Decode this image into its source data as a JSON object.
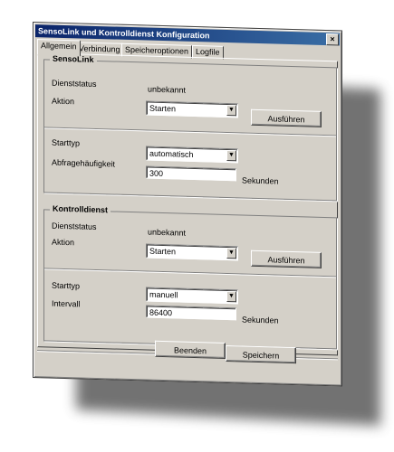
{
  "window": {
    "title": "SensoLink und Kontrolldienst Konfiguration",
    "close": "×"
  },
  "tabs": [
    "Allgemein",
    "Verbindung",
    "Speicheroptionen",
    "Logfile"
  ],
  "sensolink": {
    "group_title": "SensoLink",
    "status_label": "Dienststatus",
    "status_value": "unbekannt",
    "action_label": "Aktion",
    "action_value": "Starten",
    "execute_button": "Ausführen",
    "starttype_label": "Starttyp",
    "starttype_value": "automatisch",
    "poll_label": "Abfragehäufigkeit",
    "poll_value": "300",
    "poll_unit": "Sekunden"
  },
  "kontrolldienst": {
    "group_title": "Kontrolldienst",
    "status_label": "Dienststatus",
    "status_value": "unbekannt",
    "action_label": "Aktion",
    "action_value": "Starten",
    "execute_button": "Ausführen",
    "starttype_label": "Starttyp",
    "starttype_value": "manuell",
    "interval_label": "Intervall",
    "interval_value": "86400",
    "interval_unit": "Sekunden"
  },
  "footer": {
    "quit_button": "Beenden",
    "save_button": "Speichern"
  }
}
